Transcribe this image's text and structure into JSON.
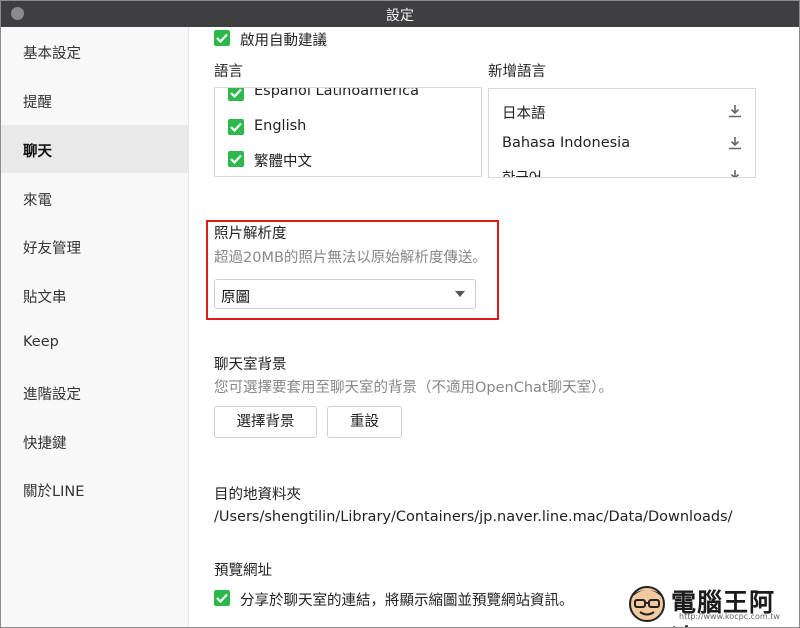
{
  "window": {
    "title": "設定"
  },
  "sidebar": {
    "items": [
      {
        "label": "基本設定",
        "active": false
      },
      {
        "label": "提醒",
        "active": false
      },
      {
        "label": "聊天",
        "active": true
      },
      {
        "label": "來電",
        "active": false
      },
      {
        "label": "好友管理",
        "active": false
      },
      {
        "label": "貼文串",
        "active": false
      },
      {
        "label": "Keep",
        "active": false
      },
      {
        "label": "進階設定",
        "active": false
      },
      {
        "label": "快捷鍵",
        "active": false
      },
      {
        "label": "關於LINE",
        "active": false
      }
    ]
  },
  "chat": {
    "auto_suggest": {
      "label": "啟用自動建議",
      "checked": true
    },
    "language": {
      "title": "語言",
      "items": [
        {
          "label": "Español Latinoamérica",
          "checked": true
        },
        {
          "label": "English",
          "checked": true
        },
        {
          "label": "繁體中文",
          "checked": true
        }
      ]
    },
    "add_language": {
      "title": "新增語言",
      "items": [
        {
          "label": "日本語",
          "icon": "download-icon"
        },
        {
          "label": "Bahasa Indonesia",
          "icon": "download-icon"
        },
        {
          "label": "한국어",
          "icon": "download-icon"
        }
      ]
    },
    "photo_resolution": {
      "title": "照片解析度",
      "description": "超過20MB的照片無法以原始解析度傳送。",
      "selected": "原圖"
    },
    "background": {
      "title": "聊天室背景",
      "description": "您可選擇要套用至聊天室的背景（不適用OpenChat聊天室）。",
      "select_label": "選擇背景",
      "reset_label": "重設"
    },
    "download_folder": {
      "title": "目的地資料夾",
      "path": "/Users/shengtilin/Library/Containers/jp.naver.line.mac/Data/Downloads/"
    },
    "link_preview": {
      "title": "預覽網址",
      "label": "分享於聊天室的連結，將顯示縮圖並預覽網站資訊。",
      "checked": true
    }
  },
  "watermark": {
    "text": "電腦王阿達",
    "url": "http://www.kocpc.com.tw"
  },
  "colors": {
    "accent_green": "#2cb94a",
    "highlight_red": "#e01919",
    "titlebar": "#3f3f41"
  }
}
